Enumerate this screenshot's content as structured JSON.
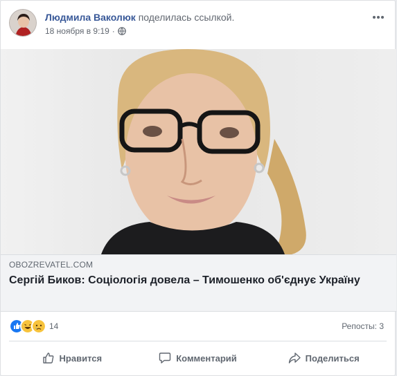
{
  "post": {
    "author": "Людмила Ваколюк",
    "action": "поделилась ссылкой.",
    "timestamp": "18 ноября в 9:19",
    "separator": "·",
    "privacy_icon": "globe-icon"
  },
  "link": {
    "domain": "OBOZREVATEL.COM",
    "title": "Сергій Биков: Соціологія довела – Тимошенко об'єднує Україну"
  },
  "reactions": {
    "icons": [
      "like",
      "haha",
      "sad"
    ],
    "count": "14",
    "shares": "Репосты: 3"
  },
  "actions": {
    "like": "Нравится",
    "comment": "Комментарий",
    "share": "Поделиться"
  },
  "colors": {
    "author_link": "#385898",
    "secondary_text": "#616770",
    "link_box_bg": "#f2f3f5",
    "like_blue": "#1877f2",
    "emoji_yellow": "#f7c33c"
  }
}
